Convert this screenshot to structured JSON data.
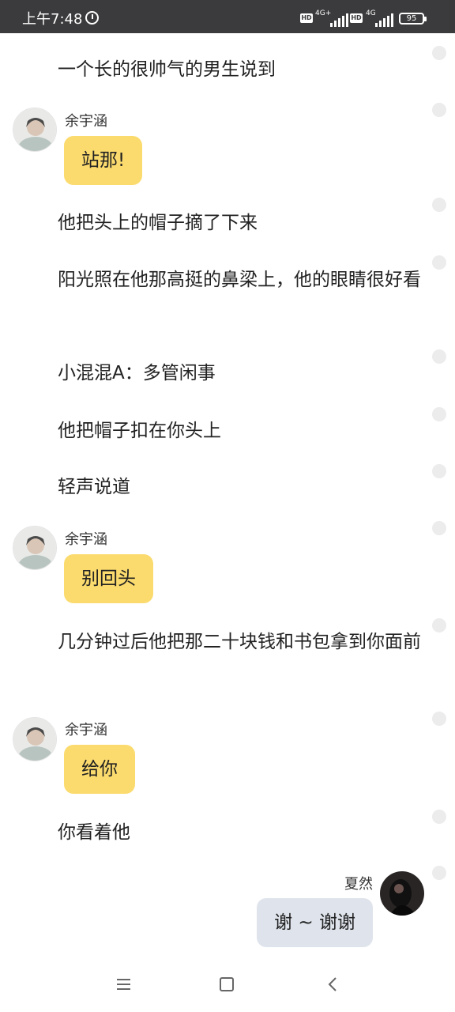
{
  "status_bar": {
    "time": "上午7:48",
    "net1": "4G+",
    "net2": "4G",
    "hd": "HD",
    "battery": "95"
  },
  "feed": {
    "n1": "一个长的很帅气的男生说到",
    "s1_name": "余宇涵",
    "s1_text": "站那!",
    "n2": "他把头上的帽子摘了下来",
    "n3": "阳光照在他那高挺的鼻梁上，他的眼睛很好看",
    "n4": "小混混A：多管闲事",
    "n5": "他把帽子扣在你头上",
    "n6": "轻声说道",
    "s2_name": "余宇涵",
    "s2_text": "别回头",
    "n7": "几分钟过后他把那二十块钱和书包拿到你面前",
    "s3_name": "余宇涵",
    "s3_text": "给你",
    "n8": "你看着他",
    "r1_name": "夏然",
    "r1_text": "谢 ~ 谢谢"
  },
  "nav": {
    "icons": [
      "menu-icon",
      "home-icon",
      "back-icon"
    ]
  },
  "colors": {
    "status_bg": "#3b3b3d",
    "bubble_left": "#fbdb6e",
    "bubble_right": "#dfe4ec"
  }
}
